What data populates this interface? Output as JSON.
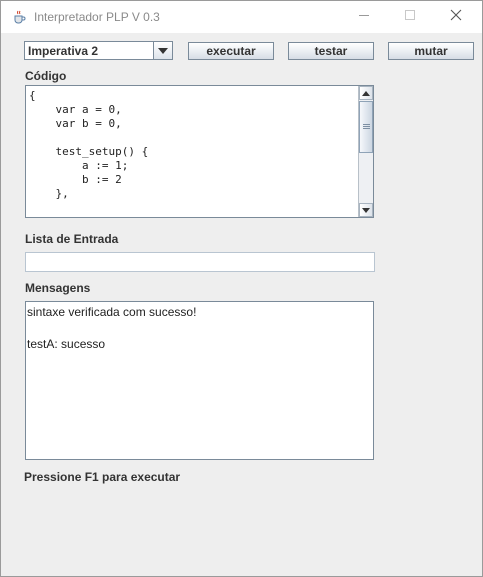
{
  "window": {
    "title": "Interpretador PLP V 0.3"
  },
  "toolbar": {
    "language_selected": "Imperativa 2",
    "execute_label": "executar",
    "test_label": "testar",
    "mutate_label": "mutar"
  },
  "code_section": {
    "label": "Código",
    "code": "{\n    var a = 0,\n    var b = 0,\n\n    test_setup() {\n        a := 1;\n        b := 2\n    },\n\n    test_testA() {"
  },
  "input_section": {
    "label": "Lista de Entrada",
    "value": ""
  },
  "messages_section": {
    "label": "Mensagens",
    "lines": [
      "sintaxe verificada com sucesso!",
      "testA: sucesso"
    ]
  },
  "status": {
    "hint": "Pressione F1 para executar"
  },
  "icons": {
    "app": "java-cup-icon",
    "minimize": "minimize-icon",
    "maximize": "maximize-icon",
    "close": "close-icon",
    "dropdown": "chevron-down-icon",
    "scroll_up": "arrow-up-icon",
    "scroll_down": "arrow-down-icon"
  }
}
